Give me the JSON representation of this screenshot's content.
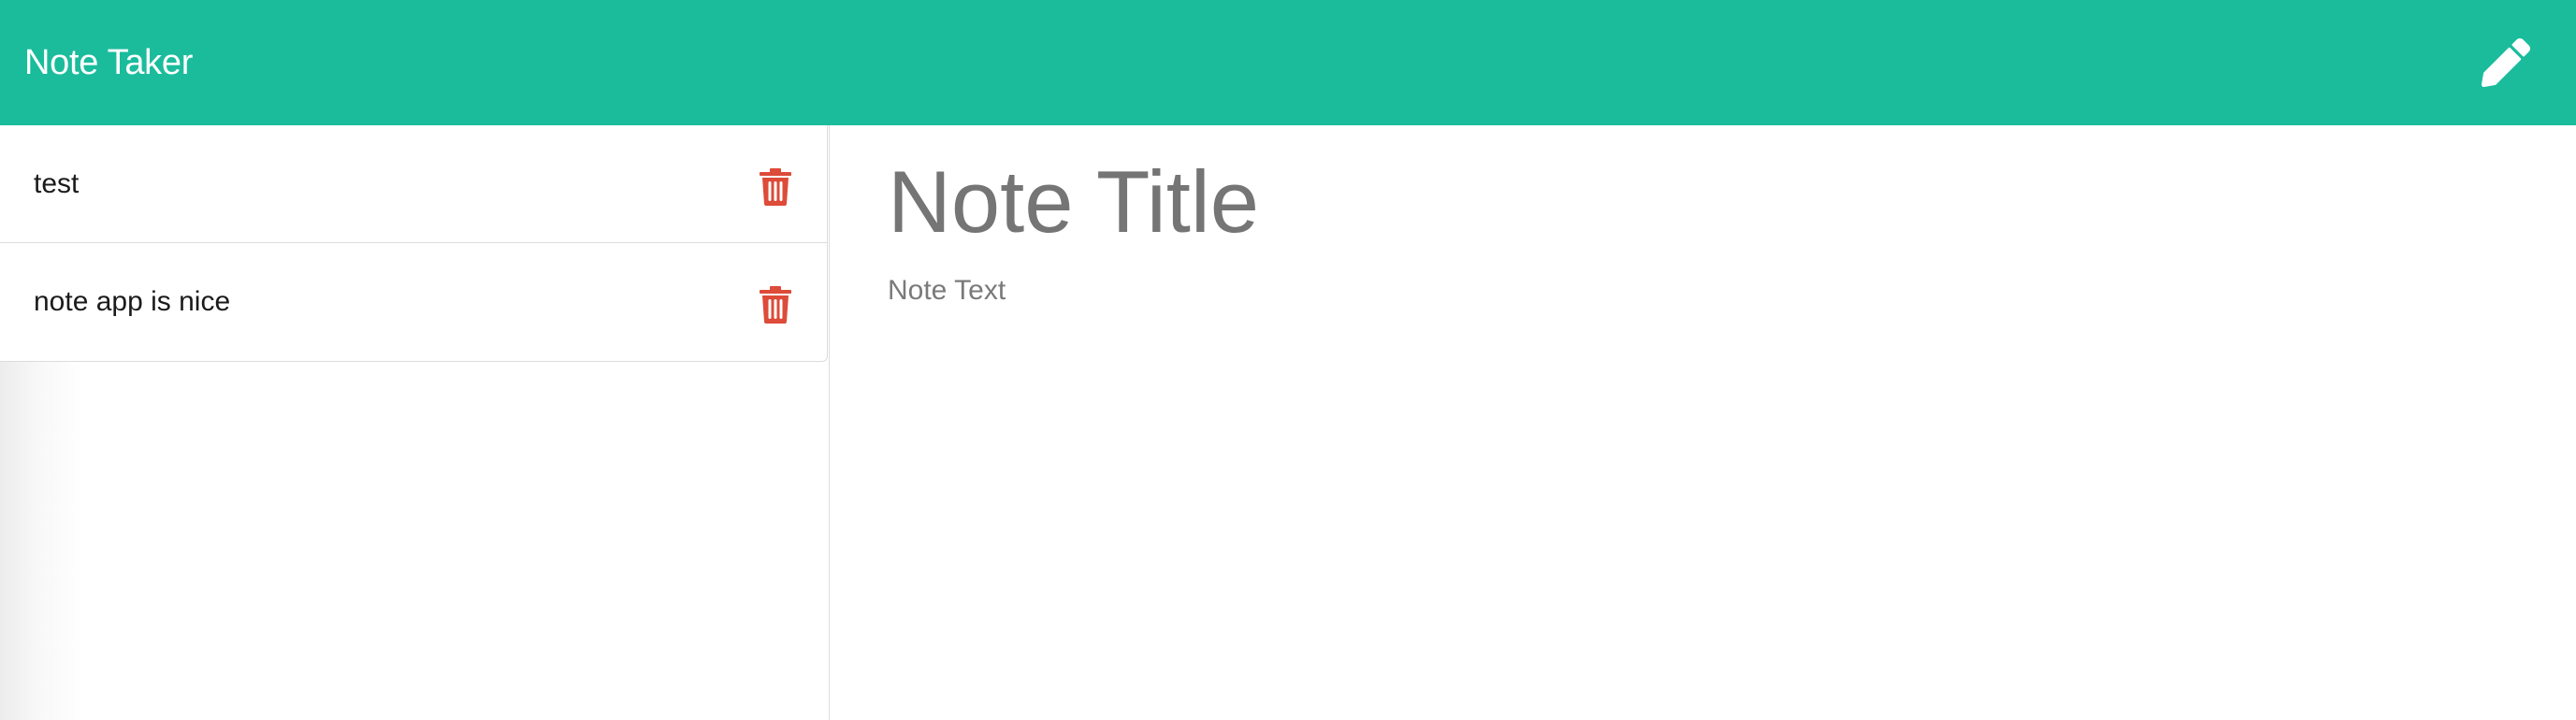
{
  "navbar": {
    "brand": "Note Taker",
    "new_note_icon": "pencil-icon",
    "background": "#1abc9c"
  },
  "sidebar": {
    "notes": [
      {
        "label": "test",
        "delete_icon": "trash-icon"
      },
      {
        "label": "note app is nice",
        "delete_icon": "trash-icon"
      }
    ],
    "delete_color": "#dd4b39"
  },
  "editor": {
    "title_placeholder": "Note Title",
    "text_placeholder": "Note Text"
  }
}
